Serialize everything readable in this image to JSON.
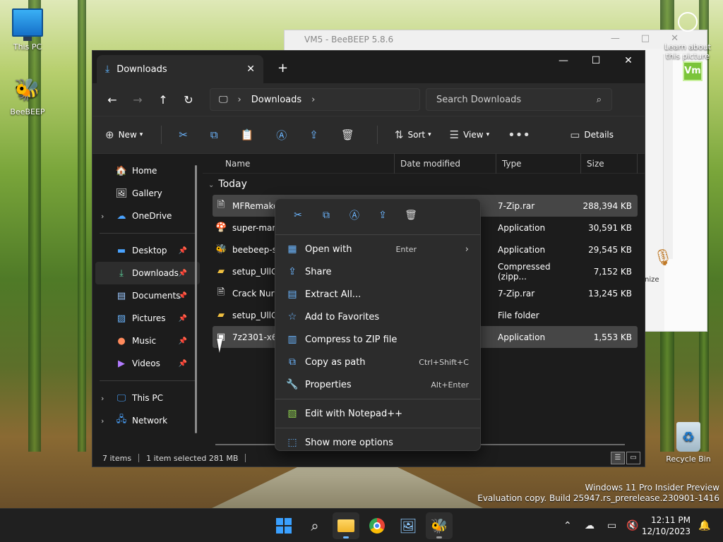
{
  "desktop": {
    "icons": {
      "this_pc": "This PC",
      "beebeep": "BeeBEEP",
      "recycle_bin": "Recycle Bin"
    },
    "learn_about": "Learn about this picture",
    "watermark": {
      "line1": "Windows 11 Pro Insider Preview",
      "line2": "Evaluation copy. Build 25947.rs_prerelease.230901-1416"
    }
  },
  "background_window": {
    "title": "VM5 - BeeBEEP 5.8.6",
    "badge": "Vm",
    "side_label": "nize"
  },
  "explorer": {
    "tab_title": "Downloads",
    "address": {
      "location": "Downloads"
    },
    "search_placeholder": "Search Downloads",
    "toolbar": {
      "new_label": "New",
      "sort_label": "Sort",
      "view_label": "View",
      "details_label": "Details"
    },
    "nav": {
      "home": "Home",
      "gallery": "Gallery",
      "onedrive": "OneDrive",
      "desktop": "Desktop",
      "downloads": "Downloads",
      "documents": "Documents",
      "pictures": "Pictures",
      "music": "Music",
      "videos": "Videos",
      "this_pc": "This PC",
      "network": "Network"
    },
    "columns": {
      "name": "Name",
      "date": "Date modified",
      "type": "Type",
      "size": "Size"
    },
    "group": "Today",
    "files": [
      {
        "name": "MFRemake",
        "type": "7-Zip.rar",
        "size": "288,394 KB"
      },
      {
        "name": "super-mari",
        "type": "Application",
        "size": "30,591 KB"
      },
      {
        "name": "beebeep-se",
        "type": "Application",
        "size": "29,545 KB"
      },
      {
        "name": "setup_UllGt",
        "type": "Compressed (zipp...",
        "size": "7,152 KB"
      },
      {
        "name": "Crack Nursi",
        "type": "7-Zip.rar",
        "size": "13,245 KB"
      },
      {
        "name": "setup_UllGt",
        "type": "File folder",
        "size": ""
      },
      {
        "name": "7z2301-x64",
        "type": "Application",
        "size": "1,553 KB"
      }
    ],
    "status": {
      "count": "7 items",
      "selection": "1 item selected  281 MB"
    }
  },
  "context_menu": {
    "items": [
      {
        "label": "Open with",
        "shortcut": "Enter"
      },
      {
        "label": "Share",
        "shortcut": ""
      },
      {
        "label": "Extract All...",
        "shortcut": ""
      },
      {
        "label": "Add to Favorites",
        "shortcut": ""
      },
      {
        "label": "Compress to ZIP file",
        "shortcut": ""
      },
      {
        "label": "Copy as path",
        "shortcut": "Ctrl+Shift+C"
      },
      {
        "label": "Properties",
        "shortcut": "Alt+Enter"
      },
      {
        "label": "Edit with Notepad++",
        "shortcut": ""
      },
      {
        "label": "Show more options",
        "shortcut": ""
      }
    ]
  },
  "taskbar": {
    "time": "12:11 PM",
    "date": "12/10/2023"
  },
  "colors": {
    "accent": "#6cb6ff",
    "explorer_bg": "#1c1c1c",
    "menu_bg": "#2c2c2c",
    "selection": "#464646"
  }
}
